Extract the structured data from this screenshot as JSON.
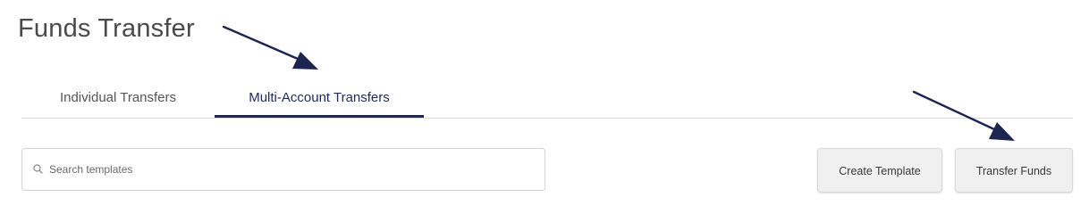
{
  "page": {
    "title": "Funds Transfer"
  },
  "tabs": [
    {
      "label": "Individual Transfers",
      "active": false
    },
    {
      "label": "Multi-Account Transfers",
      "active": true
    }
  ],
  "search": {
    "placeholder": "Search templates",
    "value": ""
  },
  "actions": {
    "create_template_label": "Create Template",
    "transfer_funds_label": "Transfer Funds"
  },
  "colors": {
    "accent": "#1f2a5c",
    "annotation_arrow": "#1c2450",
    "button_bg": "#f0f0f0",
    "border": "#d4d4d4"
  },
  "icons": {
    "search": "search-icon"
  }
}
